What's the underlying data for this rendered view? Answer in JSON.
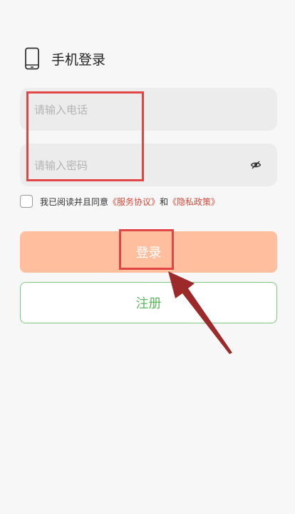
{
  "header": {
    "title": "手机登录",
    "icon": "phone-icon"
  },
  "form": {
    "phone_placeholder": "请输入电话",
    "password_placeholder": "请输入密码",
    "password_toggle_icon": "eye-off-icon"
  },
  "agreement": {
    "prefix": "我已阅读并且同意",
    "service_link": "《服务协议》",
    "conjunction": "和",
    "privacy_link": "《隐私政策》"
  },
  "buttons": {
    "login_label": "登录",
    "register_label": "注册"
  },
  "colors": {
    "login_button": "#ffbf9f",
    "register_border": "#7dc97d",
    "register_text": "#5cb85c",
    "link": "#d64a3a",
    "annotation": "#e24545",
    "arrow": "#9c2a2a"
  }
}
